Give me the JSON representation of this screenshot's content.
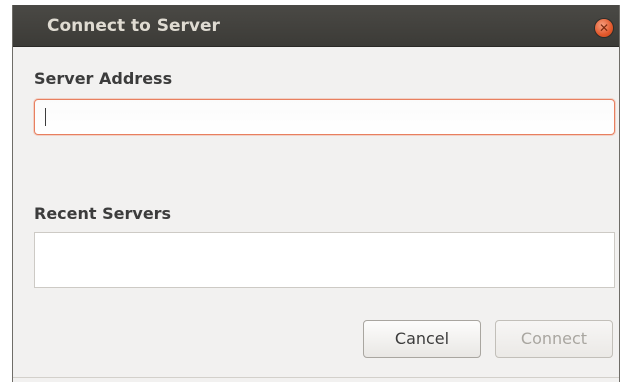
{
  "window": {
    "title": "Connect to Server",
    "close_icon": "close-icon"
  },
  "server_address": {
    "label": "Server Address",
    "value": "",
    "placeholder": ""
  },
  "recent_servers": {
    "label": "Recent Servers",
    "items": []
  },
  "buttons": {
    "cancel_label": "Cancel",
    "connect_label": "Connect",
    "connect_enabled": false
  },
  "colors": {
    "titlebar": "#3c3b37",
    "close_button": "#e2582b",
    "focus_border": "#e87f5f",
    "dialog_background": "#f2f1f0"
  }
}
